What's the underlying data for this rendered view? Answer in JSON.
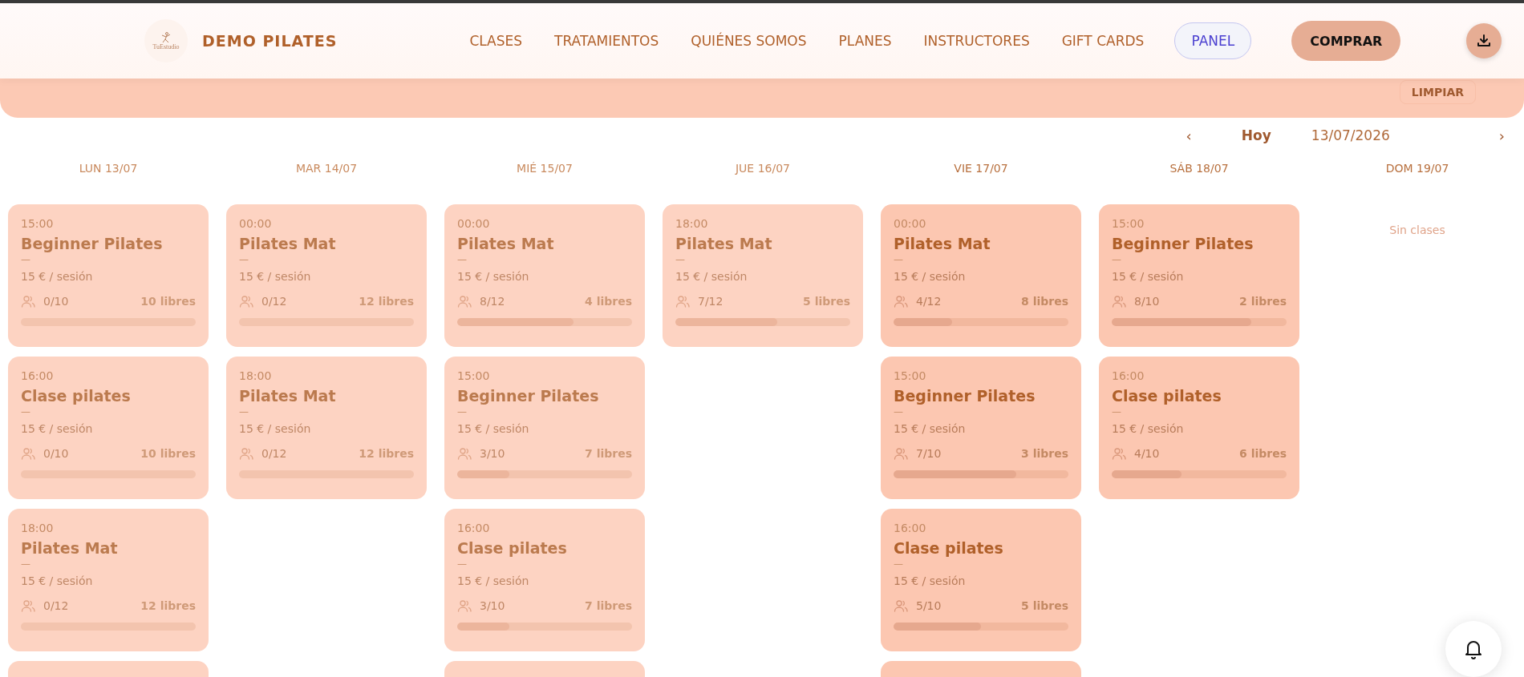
{
  "header": {
    "logo_text": "TuEstudio",
    "brand": "DEMO PILATES",
    "nav": [
      {
        "label": "CLASES"
      },
      {
        "label": "TRATAMIENTOS"
      },
      {
        "label": "QUIÉNES SOMOS"
      },
      {
        "label": "PLANES"
      },
      {
        "label": "INSTRUCTORES"
      },
      {
        "label": "GIFT CARDS"
      }
    ],
    "panel_button": "PANEL",
    "buy_button": "COMPRAR"
  },
  "filter_band": {
    "clear_button": "LIMPIAR"
  },
  "date_nav": {
    "prev": "‹",
    "today": "Hoy",
    "date": "13/07/2026",
    "next": "›"
  },
  "days": [
    {
      "label": "LUN 13/07",
      "faded": true,
      "classes": [
        {
          "time": "15:00",
          "name": "Beginner Pilates",
          "dash": "—",
          "price": "15 € / sesión",
          "count": "0/10",
          "free": "10 libres",
          "level": 0
        },
        {
          "time": "16:00",
          "name": "Clase pilates",
          "dash": "—",
          "price": "15 € / sesión",
          "count": "0/10",
          "free": "10 libres",
          "level": 0
        },
        {
          "time": "18:00",
          "name": "Pilates Mat",
          "dash": "—",
          "price": "15 € / sesión",
          "count": "0/12",
          "free": "12 libres",
          "level": 0
        }
      ],
      "more_below": true
    },
    {
      "label": "MAR 14/07",
      "faded": true,
      "classes": [
        {
          "time": "00:00",
          "name": "Pilates Mat",
          "dash": "—",
          "price": "15 € / sesión",
          "count": "0/12",
          "free": "12 libres",
          "level": 0
        },
        {
          "time": "18:00",
          "name": "Pilates Mat",
          "dash": "—",
          "price": "15 € / sesión",
          "count": "0/12",
          "free": "12 libres",
          "level": 0
        }
      ]
    },
    {
      "label": "MIÉ 15/07",
      "faded": true,
      "classes": [
        {
          "time": "00:00",
          "name": "Pilates Mat",
          "dash": "—",
          "price": "15 € / sesión",
          "count": "8/12",
          "free": "4 libres",
          "level": 0.667
        },
        {
          "time": "15:00",
          "name": "Beginner Pilates",
          "dash": "—",
          "price": "15 € / sesión",
          "count": "3/10",
          "free": "7 libres",
          "level": 0.3
        },
        {
          "time": "16:00",
          "name": "Clase pilates",
          "dash": "—",
          "price": "15 € / sesión",
          "count": "3/10",
          "free": "7 libres",
          "level": 0.3
        }
      ],
      "more_below": true
    },
    {
      "label": "JUE 16/07",
      "faded": true,
      "classes": [
        {
          "time": "18:00",
          "name": "Pilates Mat",
          "dash": "—",
          "price": "15 € / sesión",
          "count": "7/12",
          "free": "5 libres",
          "level": 0.583
        }
      ]
    },
    {
      "label": "VIE 17/07",
      "faded": false,
      "classes": [
        {
          "time": "00:00",
          "name": "Pilates Mat",
          "dash": "—",
          "price": "15 € / sesión",
          "count": "4/12",
          "free": "8 libres",
          "level": 0.333
        },
        {
          "time": "15:00",
          "name": "Beginner Pilates",
          "dash": "—",
          "price": "15 € / sesión",
          "count": "7/10",
          "free": "3 libres",
          "level": 0.7
        },
        {
          "time": "16:00",
          "name": "Clase pilates",
          "dash": "—",
          "price": "15 € / sesión",
          "count": "5/10",
          "free": "5 libres",
          "level": 0.5
        }
      ],
      "more_below": true
    },
    {
      "label": "SÁB 18/07",
      "faded": false,
      "classes": [
        {
          "time": "15:00",
          "name": "Beginner Pilates",
          "dash": "—",
          "price": "15 € / sesión",
          "count": "8/10",
          "free": "2 libres",
          "level": 0.8
        },
        {
          "time": "16:00",
          "name": "Clase pilates",
          "dash": "—",
          "price": "15 € / sesión",
          "count": "4/10",
          "free": "6 libres",
          "level": 0.4
        }
      ]
    },
    {
      "label": "DOM 19/07",
      "faded": false,
      "empty_text": "Sin clases"
    }
  ]
}
